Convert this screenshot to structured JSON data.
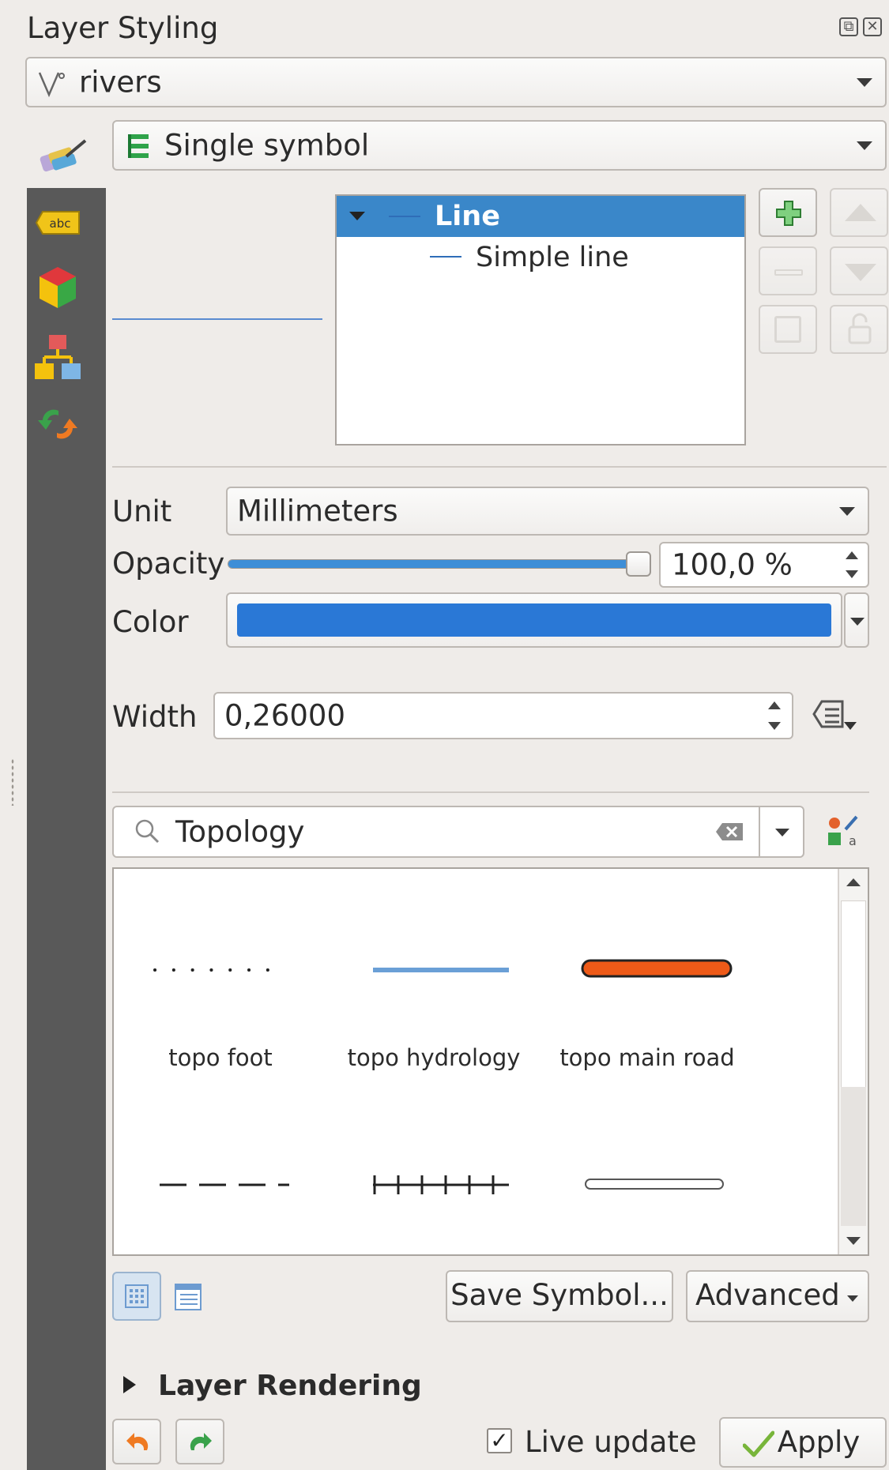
{
  "panel": {
    "title": "Layer Styling"
  },
  "layer_select": {
    "icon": "line-layer-icon",
    "value": "rivers"
  },
  "renderer_select": {
    "icon": "single-symbol-icon",
    "value": "Single symbol"
  },
  "sidebar_tabs": [
    {
      "icon": "symbology-paintbrush-icon"
    },
    {
      "icon": "labels-abc-icon"
    },
    {
      "icon": "3d-view-cube-icon"
    },
    {
      "icon": "diagrams-icon"
    },
    {
      "icon": "history-undo-redo-icon"
    }
  ],
  "symbol_tree": {
    "items": [
      {
        "label": "Line",
        "selected": true
      },
      {
        "label": "Simple line",
        "selected": false
      }
    ]
  },
  "properties": {
    "unit_label": "Unit",
    "unit_value": "Millimeters",
    "opacity_label": "Opacity",
    "opacity_value": "100,0 %",
    "opacity_fraction": 1.0,
    "color_label": "Color",
    "color_value": "#2a78d6",
    "width_label": "Width",
    "width_value": "0,26000"
  },
  "search": {
    "value": "Topology",
    "icon": "search-icon"
  },
  "symbol_library": {
    "items": [
      {
        "name": "topo foot",
        "style": "dotted"
      },
      {
        "name": "topo hydrology",
        "style": "blue-line"
      },
      {
        "name": "topo main road",
        "style": "orange-road"
      },
      {
        "name": "",
        "style": "dashed"
      },
      {
        "name": "",
        "style": "railway"
      },
      {
        "name": "",
        "style": "outline-road"
      }
    ]
  },
  "buttons": {
    "save_symbol": "Save Symbol...",
    "advanced": "Advanced",
    "apply": "Apply",
    "live_update": "Live update"
  },
  "layer_rendering": {
    "label": "Layer Rendering"
  },
  "colors": {
    "accent_blue": "#2a78d6",
    "selection_blue": "#3a87c9",
    "sidebar_gray": "#595959",
    "road_orange": "#ee5a18"
  }
}
